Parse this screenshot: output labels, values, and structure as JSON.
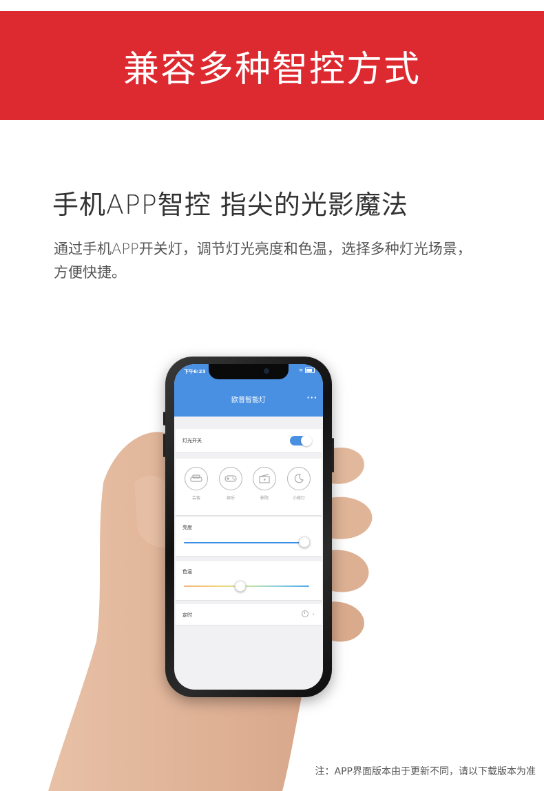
{
  "banner": {
    "title": "兼容多种智控方式"
  },
  "headline": "手机APP智控 指尖的光影魔法",
  "description": "通过手机APP开关灯，调节灯光亮度和色温，选择多种灯光场景，方便快捷。",
  "footnote": "注：APP界面版本由于更新不同，请以下载版本为准",
  "phone": {
    "status_time": "下午6:23",
    "app_title": "欧普智能灯",
    "more_icon": "more-icon",
    "light_switch": {
      "label": "灯光开关",
      "on": true
    },
    "scenes": [
      {
        "label": "会客",
        "icon": "sofa-icon"
      },
      {
        "label": "娱乐",
        "icon": "gamepad-icon"
      },
      {
        "label": "影院",
        "icon": "clapperboard-icon"
      },
      {
        "label": "小夜灯",
        "icon": "moon-icon"
      }
    ],
    "brightness": {
      "label": "亮度",
      "value_fraction": 0.96
    },
    "color_temperature": {
      "label": "色温",
      "value_fraction": 0.45
    },
    "timer": {
      "label": "定时",
      "icon": "clock-icon"
    }
  },
  "colors": {
    "banner_red": "#dd2a30",
    "app_blue": "#4a90e2"
  }
}
